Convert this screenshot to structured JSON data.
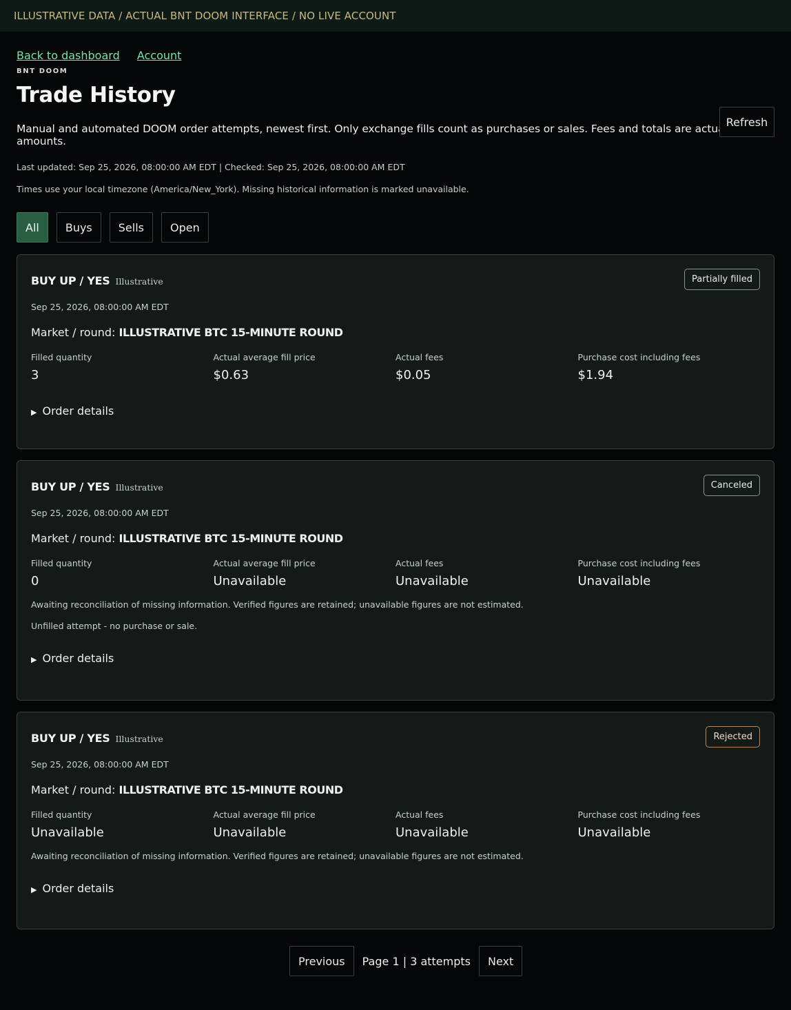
{
  "banner": "ILLUSTRATIVE DATA / ACTUAL BNT DOOM INTERFACE / NO LIVE ACCOUNT",
  "nav": {
    "back": "Back to dashboard",
    "account": "Account"
  },
  "eyebrow": "BNT DOOM",
  "title": "Trade History",
  "refresh_label": "Refresh",
  "description": "Manual and automated DOOM order attempts, newest first. Only exchange fills count as purchases or sales. Fees and totals are actual USD amounts.",
  "meta": "Last updated: Sep 25, 2026, 08:00:00 AM EDT | Checked: Sep 25, 2026, 08:00:00 AM EDT",
  "timezone_note": "Times use your local timezone (America/New_York). Missing historical information is marked unavailable.",
  "filters": [
    "All",
    "Buys",
    "Sells",
    "Open"
  ],
  "active_filter": "All",
  "trades": [
    {
      "side": "BUY UP / YES",
      "tag": "Illustrative",
      "status": "Partially filled",
      "timestamp": "Sep 25, 2026, 08:00:00 AM EDT",
      "market_label": "Market / round:",
      "market": "ILLUSTRATIVE BTC 15-MINUTE ROUND",
      "stats": [
        {
          "label": "Filled quantity",
          "value": "3"
        },
        {
          "label": "Actual average fill price",
          "value": "$0.63"
        },
        {
          "label": "Actual fees",
          "value": "$0.05"
        },
        {
          "label": "Purchase cost including fees",
          "value": "$1.94"
        }
      ],
      "details_label": "Order details"
    },
    {
      "side": "BUY UP / YES",
      "tag": "Illustrative",
      "status": "Canceled",
      "timestamp": "Sep 25, 2026, 08:00:00 AM EDT",
      "market_label": "Market / round:",
      "market": "ILLUSTRATIVE BTC 15-MINUTE ROUND",
      "stats": [
        {
          "label": "Filled quantity",
          "value": "0"
        },
        {
          "label": "Actual average fill price",
          "value": "Unavailable"
        },
        {
          "label": "Actual fees",
          "value": "Unavailable"
        },
        {
          "label": "Purchase cost including fees",
          "value": "Unavailable"
        }
      ],
      "note1": "Awaiting reconciliation of missing information. Verified figures are retained; unavailable figures are not estimated.",
      "note2": "Unfilled attempt - no purchase or sale.",
      "details_label": "Order details"
    },
    {
      "side": "BUY UP / YES",
      "tag": "Illustrative",
      "status": "Rejected",
      "timestamp": "Sep 25, 2026, 08:00:00 AM EDT",
      "market_label": "Market / round:",
      "market": "ILLUSTRATIVE BTC 15-MINUTE ROUND",
      "stats": [
        {
          "label": "Filled quantity",
          "value": "Unavailable"
        },
        {
          "label": "Actual average fill price",
          "value": "Unavailable"
        },
        {
          "label": "Actual fees",
          "value": "Unavailable"
        },
        {
          "label": "Purchase cost including fees",
          "value": "Unavailable"
        }
      ],
      "note1": "Awaiting reconciliation of missing information. Verified figures are retained; unavailable figures are not estimated.",
      "details_label": "Order details"
    }
  ],
  "pagination": {
    "previous": "Previous",
    "status": "Page 1 | 3 attempts",
    "next": "Next"
  }
}
